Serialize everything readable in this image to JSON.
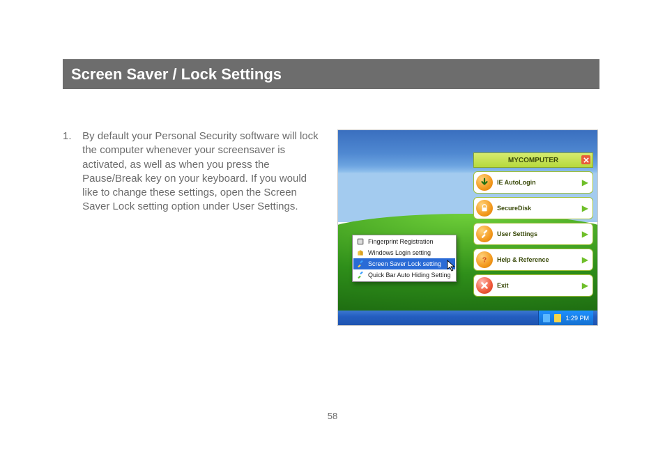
{
  "page": {
    "title": "Screen Saver / Lock Settings",
    "step_number": "1.",
    "step_text": "By default your Personal Security software will lock the computer whenever your screensaver is activated, as well as when you press the Pause/Break key on your keyboard.  If you would like to change these settings, open the Screen Saver Lock setting option under User Settings.",
    "page_number": "58"
  },
  "screenshot": {
    "quickbar": {
      "title": "MYCOMPUTER",
      "items": [
        {
          "name": "ie-autologin",
          "label": "IE AutoLogin",
          "icon": "download-arrow",
          "icon_color": "orange"
        },
        {
          "name": "securedisk",
          "label": "SecureDisk",
          "icon": "lock",
          "icon_color": "orange"
        },
        {
          "name": "user-settings",
          "label": "User Settings",
          "icon": "tools",
          "icon_color": "orange"
        },
        {
          "name": "help-reference",
          "label": "Help & Reference",
          "icon": "question",
          "icon_color": "orange"
        },
        {
          "name": "exit",
          "label": "Exit",
          "icon": "x",
          "icon_color": "red"
        }
      ]
    },
    "context_menu": {
      "items": [
        {
          "label": "Fingerprint Registration",
          "selected": false
        },
        {
          "label": "Windows Login setting",
          "selected": false
        },
        {
          "label": "Screen Saver Lock setting",
          "selected": true
        },
        {
          "label": "Quick Bar Auto Hiding Setting",
          "selected": false
        }
      ]
    },
    "taskbar": {
      "clock": "1:29 PM"
    }
  }
}
